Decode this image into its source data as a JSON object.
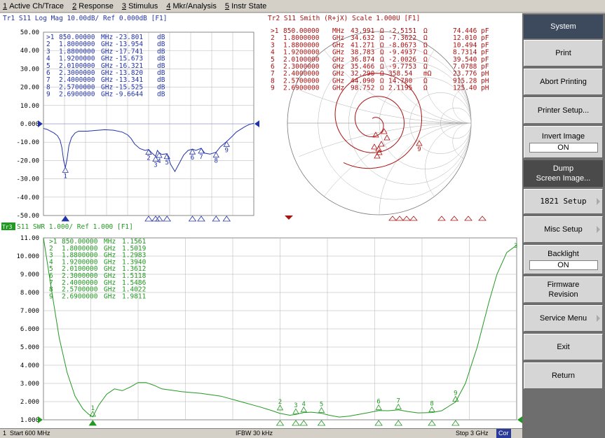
{
  "menu": [
    {
      "key": "1",
      "label": "Active Ch/Trace"
    },
    {
      "key": "2",
      "label": "Response"
    },
    {
      "key": "3",
      "label": "Stimulus"
    },
    {
      "key": "4",
      "label": "Mkr/Analysis"
    },
    {
      "key": "5",
      "label": "Instr State"
    }
  ],
  "softkeys": {
    "title": "System",
    "print": "Print",
    "abort": "Abort Printing",
    "printer_setup": "Printer Setup...",
    "invert": {
      "label": "Invert Image",
      "value": "ON"
    },
    "dump": {
      "line1": "Dump",
      "line2": "Screen Image..."
    },
    "setup_1821": "1821 Setup",
    "misc": "Misc Setup",
    "backlight": {
      "label": "Backlight",
      "value": "ON"
    },
    "firmware": {
      "line1": "Firmware",
      "line2": "Revision"
    },
    "service": "Service Menu",
    "exit": "Exit",
    "return": "Return"
  },
  "status": {
    "channel": "1",
    "start": "Start 600 MHz",
    "ifbw": "IFBW 30 kHz",
    "stop": "Stop 3 GHz",
    "cor": "Cor"
  },
  "colors": {
    "tr1": "#2233aa",
    "tr2": "#aa1111",
    "tr3": "#229922",
    "grid": "#b0b0b0",
    "ref": "#8888cc"
  },
  "chart_data": [
    {
      "type": "line",
      "title": "Tr1 S11 Log Mag 10.00dB/ Ref 0.000dB [F1]",
      "yunit": "dB",
      "yticks": [
        "50.00",
        "40.00",
        "30.00",
        "20.00",
        "10.00",
        "0.000",
        "-10.00",
        "-20.00",
        "-30.00",
        "-40.00",
        "-50.00"
      ],
      "ylim": [
        -50,
        50
      ],
      "xlim": [
        600,
        3000
      ],
      "x_unit": "MHz",
      "reference": 0,
      "series": [
        {
          "x": [
            600,
            640,
            680,
            720,
            760,
            790,
            810,
            830,
            850,
            870,
            890,
            920,
            960,
            1000,
            1100,
            1200,
            1300,
            1400,
            1500,
            1560,
            1600,
            1640,
            1700,
            1760,
            1800,
            1840,
            1880,
            1900,
            1920,
            1950,
            2010,
            2050,
            2100,
            2200,
            2250,
            2300,
            2340,
            2400,
            2440,
            2500,
            2570,
            2620,
            2690,
            2760,
            2800,
            2850,
            2900,
            2950,
            3000
          ],
          "y": [
            -2.5,
            -3,
            -4,
            -5,
            -6.5,
            -9,
            -13,
            -20,
            -23.8,
            -19,
            -12,
            -7.5,
            -5,
            -4,
            -4,
            -3.6,
            -3.2,
            -3.5,
            -4.5,
            -6,
            -8,
            -11,
            -13.5,
            -14.5,
            -14,
            -16,
            -17.7,
            -14.5,
            -15.7,
            -16.7,
            -16.3,
            -22,
            -26,
            -17,
            -14.5,
            -13.8,
            -14.5,
            -13.3,
            -16,
            -16.5,
            -15.5,
            -12.5,
            -9.7,
            -6.5,
            -4.5,
            -3,
            -1.5,
            -0.3,
            0.3
          ]
        }
      ],
      "markers": [
        {
          "id": ">1",
          "freq": "850.00000",
          "unit": "MHz",
          "value": "-23.801",
          "vunit": "dB"
        },
        {
          "id": "2",
          "freq": "1.8000000",
          "unit": "GHz",
          "value": "-13.954",
          "vunit": "dB"
        },
        {
          "id": "3",
          "freq": "1.8800000",
          "unit": "GHz",
          "value": "-17.741",
          "vunit": "dB"
        },
        {
          "id": "4",
          "freq": "1.9200000",
          "unit": "GHz",
          "value": "-15.673",
          "vunit": "dB"
        },
        {
          "id": "5",
          "freq": "2.0100000",
          "unit": "GHz",
          "value": "-16.321",
          "vunit": "dB"
        },
        {
          "id": "6",
          "freq": "2.3000000",
          "unit": "GHz",
          "value": "-13.820",
          "vunit": "dB"
        },
        {
          "id": "7",
          "freq": "2.4000000",
          "unit": "GHz",
          "value": "-13.341",
          "vunit": "dB"
        },
        {
          "id": "8",
          "freq": "2.5700000",
          "unit": "GHz",
          "value": "-15.525",
          "vunit": "dB"
        },
        {
          "id": "9",
          "freq": "2.6900000",
          "unit": "GHz",
          "value": "-9.6644",
          "vunit": "dB"
        }
      ]
    },
    {
      "type": "smith",
      "title": "Tr2 S11 Smith (R+jX) Scale 1.000U [F1]",
      "markers": [
        {
          "id": ">1",
          "freq": "850.00000",
          "unit": "MHz",
          "r": "43.991",
          "ru": "Ω",
          "x": "-2.5151",
          "xu": "Ω",
          "c": "74.446",
          "cu": "pF"
        },
        {
          "id": "2",
          "freq": "1.8000000",
          "unit": "GHz",
          "r": "34.632",
          "ru": "Ω",
          "x": "-7.3622",
          "xu": "Ω",
          "c": "12.010",
          "cu": "pF"
        },
        {
          "id": "3",
          "freq": "1.8800000",
          "unit": "GHz",
          "r": "41.271",
          "ru": "Ω",
          "x": "-8.0673",
          "xu": "Ω",
          "c": "10.494",
          "cu": "pF"
        },
        {
          "id": "4",
          "freq": "1.9200000",
          "unit": "GHz",
          "r": "38.783",
          "ru": "Ω",
          "x": "-9.4937",
          "xu": "Ω",
          "c": "8.7314",
          "cu": "pF"
        },
        {
          "id": "5",
          "freq": "2.0100000",
          "unit": "GHz",
          "r": "36.874",
          "ru": "Ω",
          "x": "-2.0026",
          "xu": "Ω",
          "c": "39.540",
          "cu": "pF"
        },
        {
          "id": "6",
          "freq": "2.3000000",
          "unit": "GHz",
          "r": "35.466",
          "ru": "Ω",
          "x": "-9.7753",
          "xu": "Ω",
          "c": "7.0788",
          "cu": "pF"
        },
        {
          "id": "7",
          "freq": "2.4000000",
          "unit": "GHz",
          "r": "32.290",
          "ru": "Ω",
          "x": "358.54",
          "xu": "mΩ",
          "c": "23.776",
          "cu": "pH"
        },
        {
          "id": "8",
          "freq": "2.5700000",
          "unit": "GHz",
          "r": "44.090",
          "ru": "Ω",
          "x": "14.780",
          "xu": "Ω",
          "c": "915.28",
          "cu": "pH"
        },
        {
          "id": "9",
          "freq": "2.6900000",
          "unit": "GHz",
          "r": "98.752",
          "ru": "Ω",
          "x": "2.1195",
          "xu": "Ω",
          "c": "125.40",
          "cu": "pH"
        }
      ]
    },
    {
      "type": "line",
      "title": "S11 SWR 1.000/ Ref 1.000 [F1]",
      "badge": "Tr3",
      "yticks": [
        "11.00",
        "10.000",
        "9.000",
        "8.000",
        "7.000",
        "6.000",
        "5.000",
        "4.000",
        "3.000",
        "2.000",
        "1.000"
      ],
      "ylim": [
        1,
        11
      ],
      "xlim": [
        600,
        3000
      ],
      "x_unit": "MHz",
      "reference": 1,
      "series": [
        {
          "x": [
            600,
            640,
            680,
            720,
            760,
            800,
            830,
            850,
            880,
            920,
            960,
            1000,
            1040,
            1080,
            1120,
            1160,
            1200,
            1300,
            1400,
            1500,
            1600,
            1700,
            1760,
            1800,
            1850,
            1880,
            1920,
            1960,
            2010,
            2050,
            2100,
            2150,
            2200,
            2250,
            2300,
            2350,
            2400,
            2450,
            2500,
            2570,
            2620,
            2690,
            2740,
            2800,
            2860,
            2900,
            2950,
            3000
          ],
          "y": [
            11,
            8.2,
            5.5,
            3.6,
            2.3,
            1.6,
            1.3,
            1.16,
            1.8,
            2.4,
            2.7,
            2.6,
            2.8,
            3.05,
            3.05,
            2.9,
            2.7,
            2.55,
            2.45,
            2.3,
            2.0,
            1.7,
            1.5,
            1.35,
            1.25,
            1.3,
            1.4,
            1.42,
            1.36,
            1.25,
            1.15,
            1.2,
            1.3,
            1.4,
            1.51,
            1.5,
            1.55,
            1.45,
            1.38,
            1.4,
            1.5,
            1.98,
            3.0,
            5.0,
            7.5,
            9.0,
            10.2,
            10.6
          ]
        }
      ],
      "markers": [
        {
          "id": ">1",
          "freq": "850.00000",
          "unit": "MHz",
          "value": "1.1561"
        },
        {
          "id": "2",
          "freq": "1.8000000",
          "unit": "GHz",
          "value": "1.5019"
        },
        {
          "id": "3",
          "freq": "1.8800000",
          "unit": "GHz",
          "value": "1.2983"
        },
        {
          "id": "4",
          "freq": "1.9200000",
          "unit": "GHz",
          "value": "1.3940"
        },
        {
          "id": "5",
          "freq": "2.0100000",
          "unit": "GHz",
          "value": "1.3612"
        },
        {
          "id": "6",
          "freq": "2.3000000",
          "unit": "GHz",
          "value": "1.5118"
        },
        {
          "id": "7",
          "freq": "2.4000000",
          "unit": "GHz",
          "value": "1.5486"
        },
        {
          "id": "8",
          "freq": "2.5700000",
          "unit": "GHz",
          "value": "1.4022"
        },
        {
          "id": "9",
          "freq": "2.6900000",
          "unit": "GHz",
          "value": "1.9811"
        }
      ]
    }
  ]
}
